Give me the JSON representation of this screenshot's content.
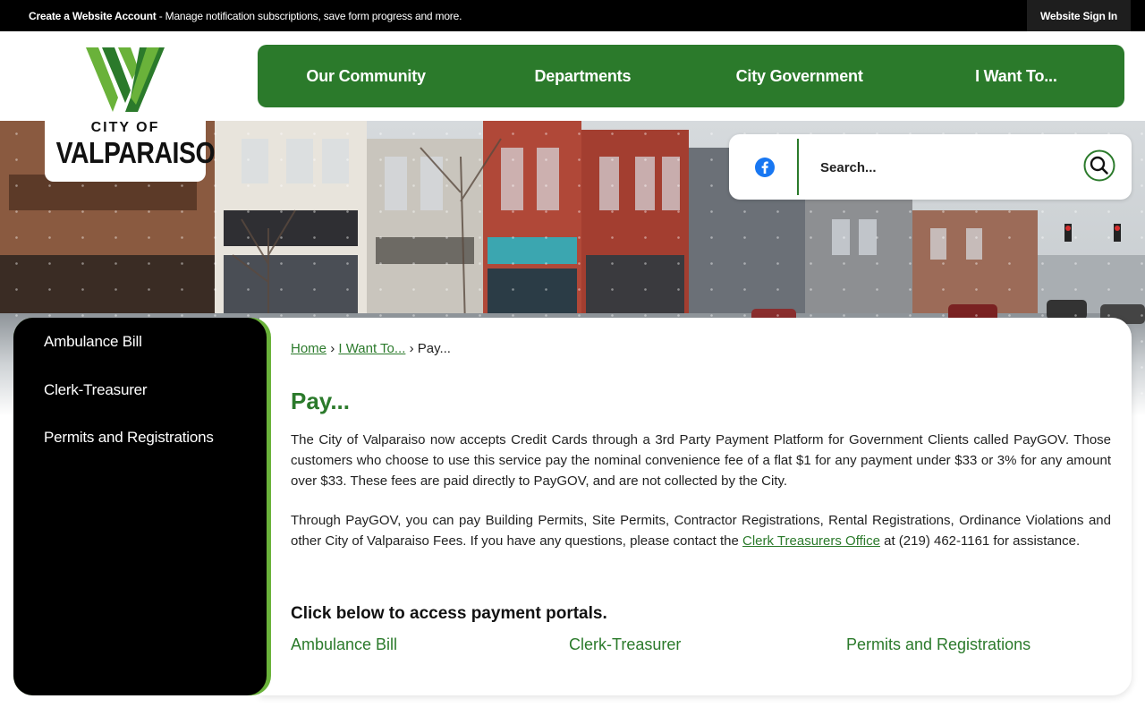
{
  "topbar": {
    "account_bold": "Create a Website Account",
    "account_rest": " - Manage notification subscriptions, save form progress and more.",
    "signin_label": "Website Sign In"
  },
  "logo": {
    "line1": "CITY OF",
    "line2": "VALPARAISO"
  },
  "nav": {
    "items": [
      "Our Community",
      "Departments",
      "City Government",
      "I Want To..."
    ]
  },
  "search": {
    "placeholder": "Search...",
    "social_icon": "facebook-icon",
    "button_icon": "search-icon"
  },
  "sidebar": {
    "items": [
      "Ambulance Bill",
      "Clerk-Treasurer",
      "Permits and Registrations"
    ]
  },
  "breadcrumb": {
    "home": "Home",
    "sep": "›",
    "level1": "I Want To...",
    "current": "Pay..."
  },
  "page": {
    "title": "Pay...",
    "para1": "The City of Valparaiso now accepts Credit Cards through a 3rd Party Payment Platform for Government Clients called PayGOV. Those customers who choose to use this service pay the nominal convenience fee of a flat $1 for any payment under $33 or 3% for any amount over $33. These fees are paid directly to PayGOV, and are not collected by the City.",
    "para2_before": "Through PayGOV, you can pay Building Permits, Site Permits, Contractor Registrations, Rental Registrations, Ordinance Violations and other City of Valparaiso Fees. If you have any questions, please contact the ",
    "para2_link": "Clerk Treasurers Office",
    "para2_after": " at (219) 462-1161 for assistance.",
    "portals_heading": "Click below to access payment portals.",
    "portals": [
      "Ambulance Bill",
      "Clerk-Treasurer",
      "Permits and Registrations"
    ]
  },
  "colors": {
    "brand_green": "#2b7a2b",
    "accent_lime": "#6ab23a",
    "topbar": "#000000"
  }
}
